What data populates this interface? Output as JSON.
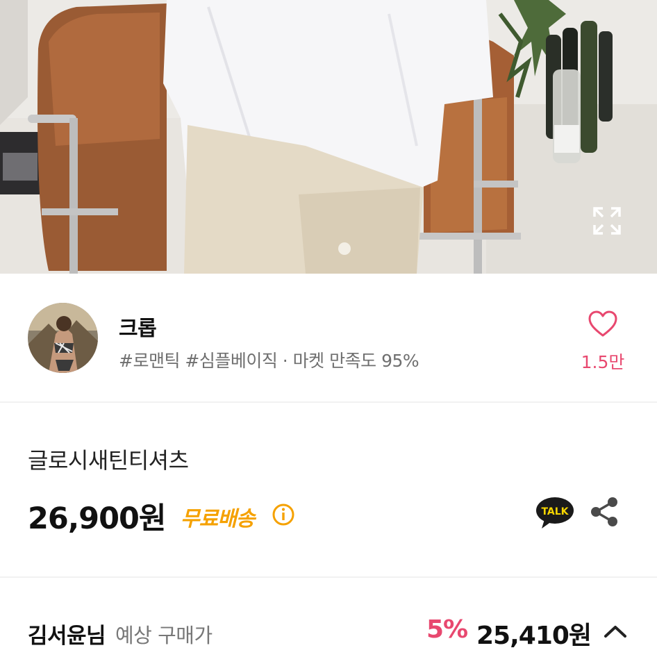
{
  "hero": {
    "alt": "product photo",
    "expand_icon": "expand-icon"
  },
  "shop": {
    "name": "크롭",
    "tags": "#로맨틱 #심플베이직 · 마켓 만족도 95%",
    "like_count": "1.5만",
    "like_icon": "heart-outline-icon",
    "accent_color": "#e8486f"
  },
  "product": {
    "name": "글로시새틴티셔츠",
    "price": "26,900원",
    "free_shipping": "무료배송",
    "free_shipping_color": "#f5a100",
    "talk_label": "TALK",
    "share_icon": "share-icon",
    "info_icon": "info-icon"
  },
  "expected": {
    "buyer": "김서윤님",
    "label": "예상 구매가",
    "discount": "5%",
    "price": "25,410원",
    "toggle_icon": "chevron-up-icon"
  }
}
